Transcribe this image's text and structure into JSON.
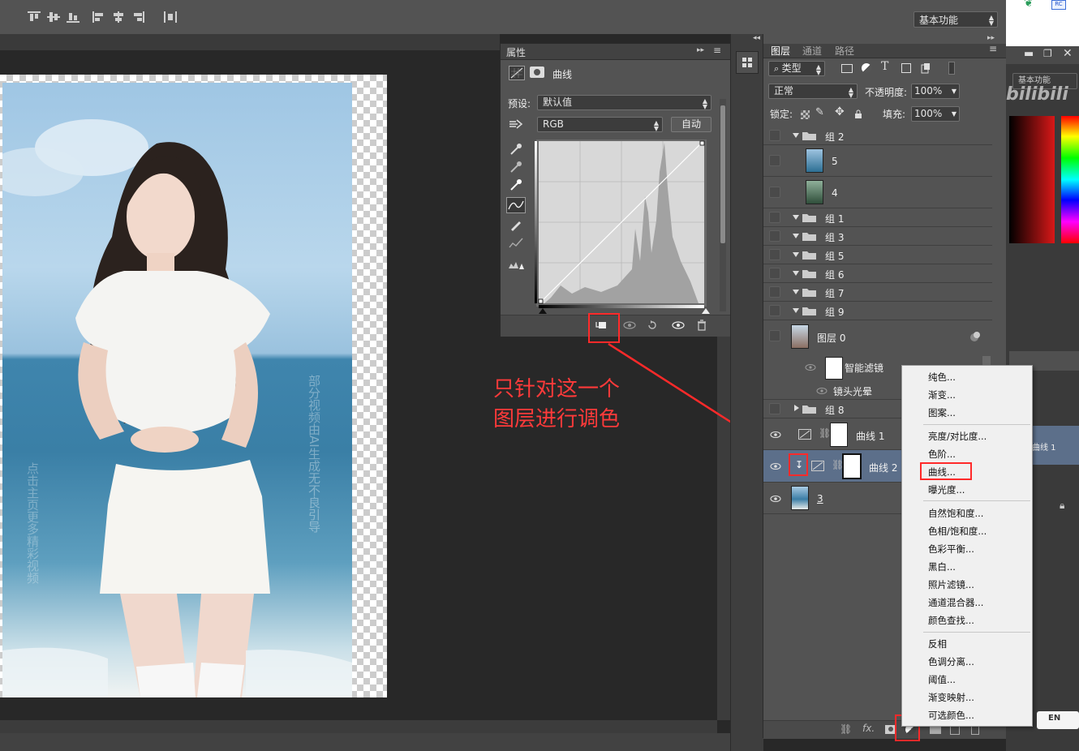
{
  "options_bar": {
    "workspace": "基本功能"
  },
  "annotation": {
    "line1": "只针对这一个",
    "line2": "图层进行调色"
  },
  "properties_panel": {
    "tab": "属性",
    "title": "曲线",
    "preset_label": "预设:",
    "preset_value": "默认值",
    "channel_value": "RGB",
    "auto_button": "自动"
  },
  "layers_panel": {
    "tabs": [
      "图层",
      "通道",
      "路径"
    ],
    "filter_kind": "类型",
    "blend_mode": "正常",
    "opacity_label": "不透明度:",
    "opacity_value": "100%",
    "lock_label": "锁定:",
    "fill_label": "填充:",
    "fill_value": "100%",
    "layers": [
      {
        "name": "组 2",
        "type": "group",
        "visible": false,
        "expanded": true
      },
      {
        "name": "5",
        "type": "image",
        "visible": false
      },
      {
        "name": "4",
        "type": "image",
        "visible": false
      },
      {
        "name": "组 1",
        "type": "group",
        "visible": false,
        "expanded": true
      },
      {
        "name": "组 3",
        "type": "group",
        "visible": false,
        "expanded": true
      },
      {
        "name": "组 5",
        "type": "group",
        "visible": false,
        "expanded": true
      },
      {
        "name": "组 6",
        "type": "group",
        "visible": false,
        "expanded": true
      },
      {
        "name": "组 7",
        "type": "group",
        "visible": false,
        "expanded": true
      },
      {
        "name": "组 9",
        "type": "group",
        "visible": false,
        "expanded": true
      },
      {
        "name": "图层 0",
        "type": "smart-object",
        "visible": false
      },
      {
        "name": "智能滤镜",
        "type": "smart-filter",
        "visible": true
      },
      {
        "name": "镜头光晕",
        "type": "filter",
        "visible": true
      },
      {
        "name": "组 8",
        "type": "group",
        "visible": false,
        "expanded": false
      },
      {
        "name": "曲线 1",
        "type": "adjustment",
        "visible": true
      },
      {
        "name": "曲线 2",
        "type": "adjustment",
        "visible": true,
        "selected": true,
        "clipped": true
      },
      {
        "name": "3",
        "type": "image",
        "visible": true
      }
    ]
  },
  "adjustment_menu": {
    "groups": [
      [
        "纯色...",
        "渐变...",
        "图案..."
      ],
      [
        "亮度/对比度...",
        "色阶...",
        "曲线...",
        "曝光度..."
      ],
      [
        "自然饱和度...",
        "色相/饱和度...",
        "色彩平衡...",
        "黑白...",
        "照片滤镜...",
        "通道混合器...",
        "颜色查找..."
      ],
      [
        "反相",
        "色调分离...",
        "阈值...",
        "渐变映射...",
        "可选颜色..."
      ]
    ],
    "highlighted": "曲线..."
  },
  "right_area": {
    "panel_label": "基本功能",
    "layer_label": "曲线 1",
    "lang": "EN"
  },
  "watermarks": [
    "部分视频由AI生成无不良引导",
    "点击主页更多精彩视频"
  ],
  "colors": {
    "annotation_red": "#ff2a2a",
    "panel_bg": "#535353",
    "selected_layer": "#5c6f8a"
  }
}
